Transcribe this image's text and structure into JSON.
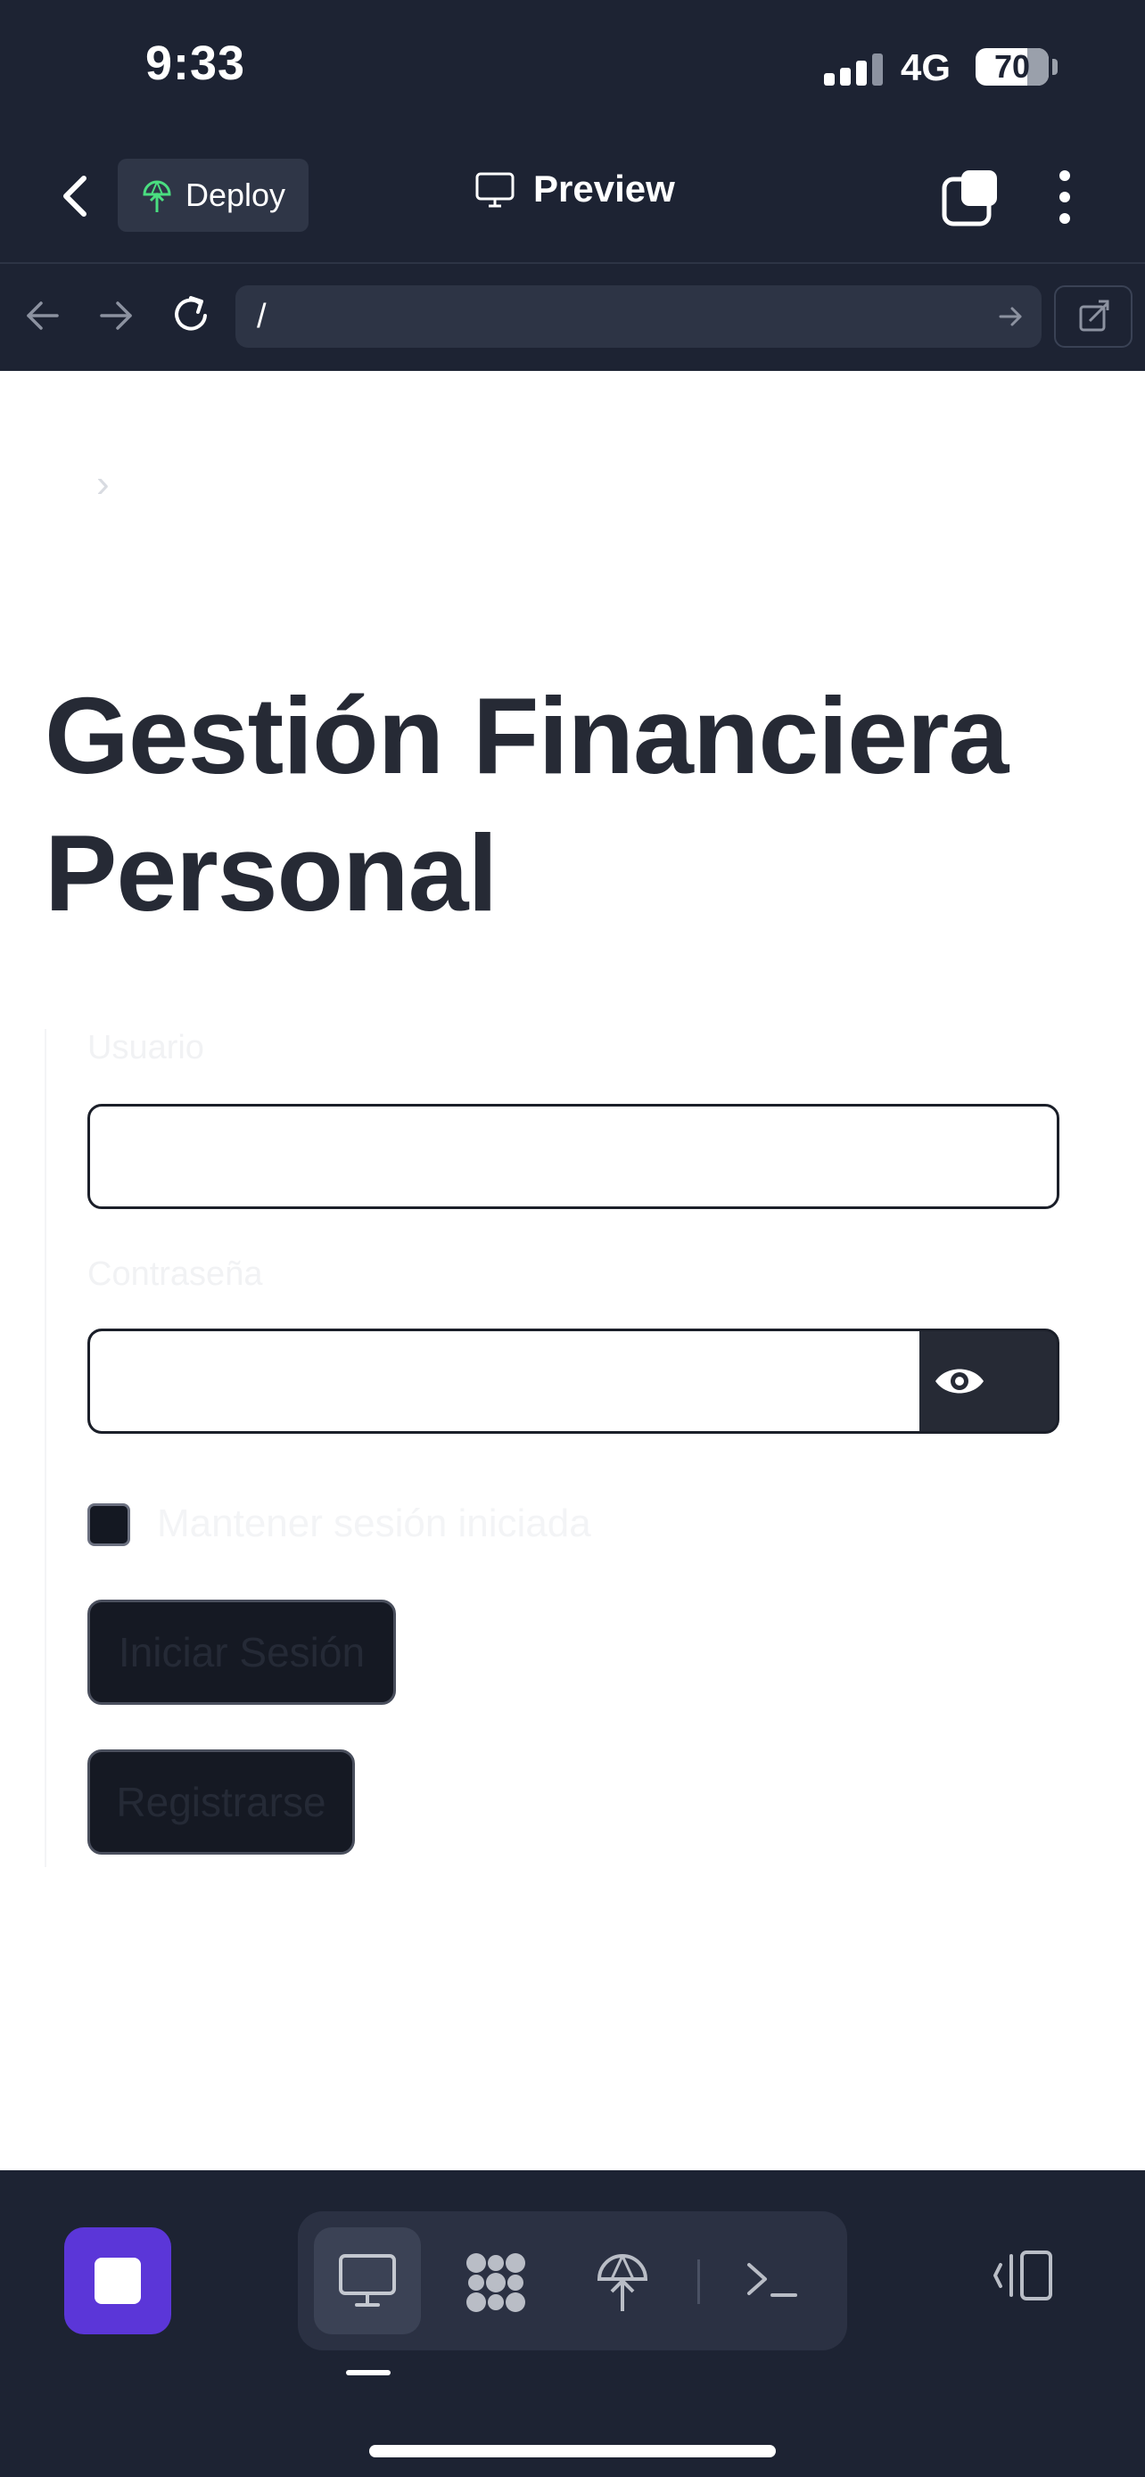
{
  "status_bar": {
    "time": "9:33",
    "network": "4G",
    "battery": "70"
  },
  "header": {
    "deploy_label": "Deploy",
    "preview_label": "Preview"
  },
  "url_bar": {
    "url": "/"
  },
  "page": {
    "title": "Gestión Financiera Personal",
    "form": {
      "username_label": "Usuario",
      "username_value": "",
      "password_label": "Contraseña",
      "password_value": "",
      "remember_label": "Mantener sesión iniciada",
      "remember_checked": false,
      "login_button": "Iniciar Sesión",
      "register_button": "Registrarse"
    }
  },
  "bottom_bar": {
    "tools": [
      "desktop-preview",
      "workflow",
      "deploy",
      "terminal"
    ],
    "active_tool": "desktop-preview"
  },
  "colors": {
    "chrome_bg": "#1d2333",
    "accent": "#5b36d8",
    "deploy_icon": "#4ade80",
    "title_text": "#262a35"
  }
}
